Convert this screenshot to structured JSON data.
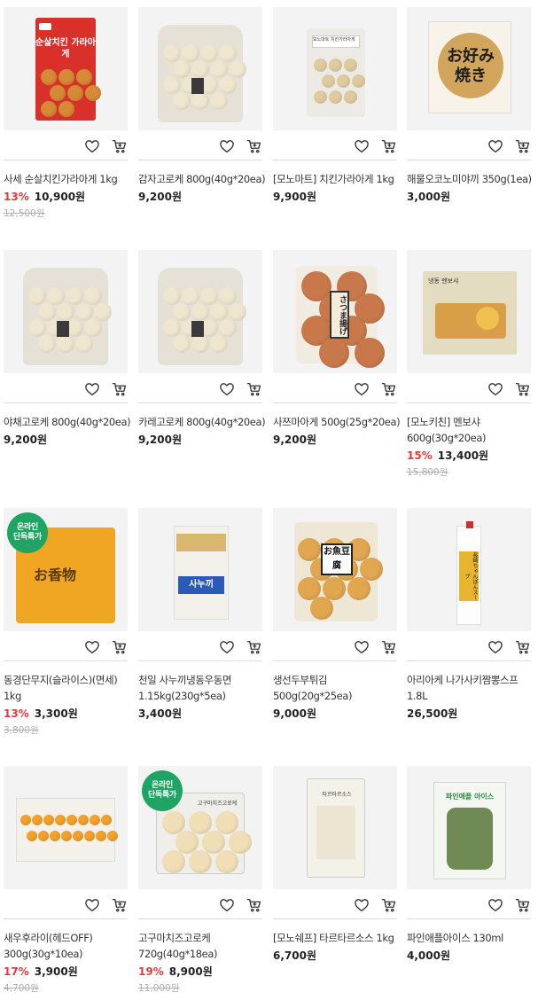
{
  "colors": {
    "discount": "#e8383d",
    "badge": "#1fa463",
    "divider": "#d9d9d9",
    "original_price": "#b0b0b0"
  },
  "icons": {
    "wishlist": "heart-icon",
    "cart": "cart-icon"
  },
  "products": [
    {
      "title": "사세 순살치킨가라아게 1kg",
      "discount": "13%",
      "price": "10,900원",
      "original": "12,500원",
      "badge": "",
      "pack_text": "순살치킨 가라아게"
    },
    {
      "title": "감자고로케 800g(40g*20ea)",
      "discount": "",
      "price": "9,200원",
      "original": "",
      "badge": "",
      "pack_text": ""
    },
    {
      "title": "[모노마트] 치킨가라아게 1kg",
      "discount": "",
      "price": "9,900원",
      "original": "",
      "badge": "",
      "pack_text": "모노마트 치킨가라아게"
    },
    {
      "title": "해물오코노미야끼 350g(1ea)",
      "discount": "",
      "price": "3,000원",
      "original": "",
      "badge": "",
      "pack_text": "お好み焼き"
    },
    {
      "title": "야채고로케 800g(40g*20ea)",
      "discount": "",
      "price": "9,200원",
      "original": "",
      "badge": "",
      "pack_text": ""
    },
    {
      "title": "카레고로케 800g(40g*20ea)",
      "discount": "",
      "price": "9,200원",
      "original": "",
      "badge": "",
      "pack_text": ""
    },
    {
      "title": "사쯔마아게 500g(25g*20ea)",
      "discount": "",
      "price": "9,200원",
      "original": "",
      "badge": "",
      "pack_text": "さつま揚げ"
    },
    {
      "title": "[모노키친] 멘보샤 600g(30g*20ea)",
      "discount": "15%",
      "price": "13,400원",
      "original": "15,800원",
      "badge": "",
      "pack_text": "냉동 멘보샤"
    },
    {
      "title": "동경단무지(슬라이스)(면세) 1kg",
      "discount": "13%",
      "price": "3,300원",
      "original": "3,800원",
      "badge": "온라인 단독특가",
      "pack_text": "お香物"
    },
    {
      "title": "천일 사누끼냉동우동면 1.15kg(230g*5ea)",
      "discount": "",
      "price": "3,400원",
      "original": "",
      "badge": "",
      "pack_text": "사누끼"
    },
    {
      "title": "생선두부튀김 500g(20g*25ea)",
      "discount": "",
      "price": "9,000원",
      "original": "",
      "badge": "",
      "pack_text": "お魚豆腐"
    },
    {
      "title": "아리아케 나가사키짬뽕스프 1.8L",
      "discount": "",
      "price": "26,500원",
      "original": "",
      "badge": "",
      "pack_text": "長崎ちゃんぽんスープ"
    },
    {
      "title": "새우후라이(헤드OFF) 300g(30g*10ea)",
      "discount": "17%",
      "price": "3,900원",
      "original": "4,700원",
      "badge": "",
      "pack_text": ""
    },
    {
      "title": "고구마치즈고로케 720g(40g*18ea)",
      "discount": "19%",
      "price": "8,900원",
      "original": "11,000원",
      "badge": "온라인 단독특가",
      "pack_text": "고구마치즈고로케"
    },
    {
      "title": "[모노쉐프] 타르타르소스 1kg",
      "discount": "",
      "price": "6,700원",
      "original": "",
      "badge": "",
      "pack_text": "타르타르소스"
    },
    {
      "title": "파인애플아이스 130ml",
      "discount": "",
      "price": "4,000원",
      "original": "",
      "badge": "",
      "pack_text": "파인애플 아이스"
    }
  ]
}
